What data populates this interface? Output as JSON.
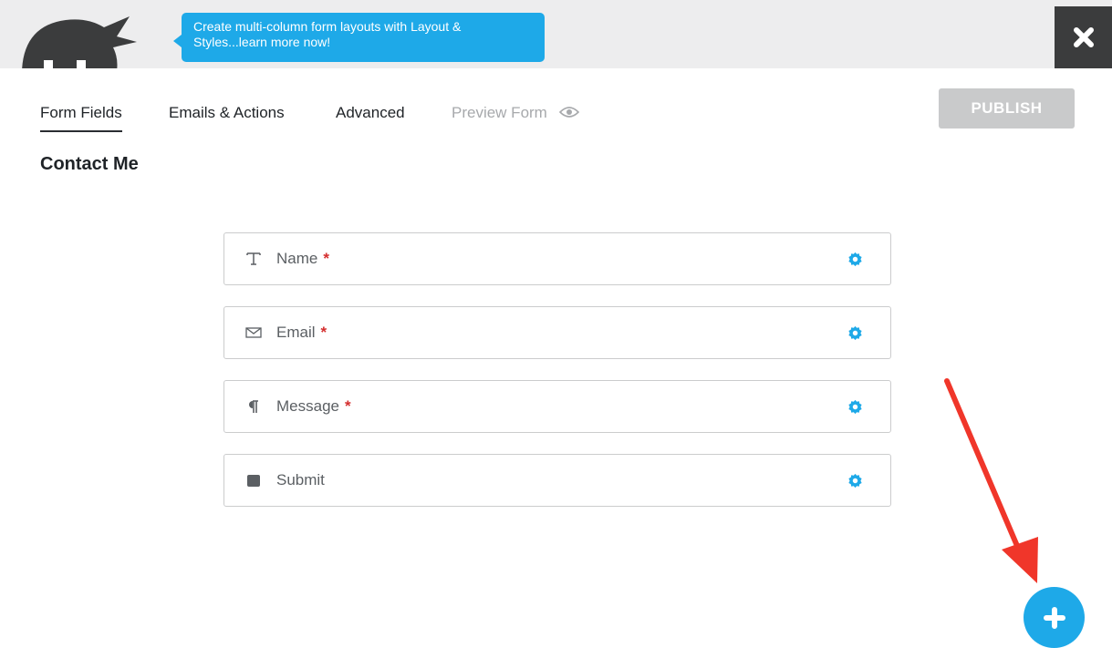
{
  "promo": {
    "text": "Create multi-column form layouts with Layout & Styles...learn more now!"
  },
  "close": {
    "icon": "close-icon"
  },
  "tabs": [
    {
      "label": "Form Fields",
      "active": true
    },
    {
      "label": "Emails & Actions"
    },
    {
      "label": "Advanced"
    },
    {
      "label": "Preview Form",
      "disabled": true,
      "icon": "eye-icon"
    }
  ],
  "publish": {
    "label": "PUBLISH"
  },
  "form": {
    "title": "Contact Me",
    "fields": [
      {
        "label": "Name",
        "required": "*",
        "icon": "text-field-icon"
      },
      {
        "label": "Email",
        "required": "*",
        "icon": "envelope-icon"
      },
      {
        "label": "Message",
        "required": "*",
        "icon": "paragraph-icon"
      },
      {
        "label": "Submit",
        "required": "",
        "icon": "square-button-icon"
      }
    ]
  },
  "colors": {
    "accent": "#1ea9e8",
    "required": "#d42e2e",
    "arrow": "#f0362a",
    "dark": "#3b3c3d"
  },
  "add_button": {
    "icon": "plus-icon"
  }
}
